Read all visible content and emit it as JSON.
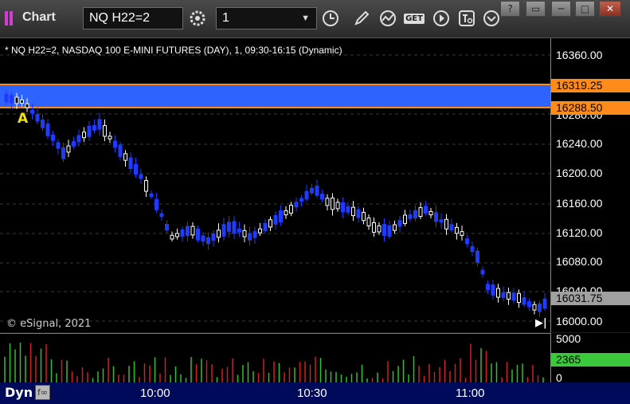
{
  "window": {
    "title": "Chart",
    "symbol": "NQ H22=2",
    "interval": "1"
  },
  "chart": {
    "description": "* NQ H22=2, NASDAQ 100 E-MINI FUTURES (DAY), 1, 09:30-16:15 (Dynamic)",
    "watermark": "© eSignal, 2021",
    "marker_label": "A",
    "price_ticks": [
      "16360.00",
      "16280.00",
      "16240.00",
      "16200.00",
      "16160.00",
      "16120.00",
      "16080.00",
      "16040.00",
      "16000.00"
    ],
    "level_high": "16319.25",
    "level_low": "16288.50",
    "last_price": "16031.75",
    "colors": {
      "band": "#2f63ff",
      "level": "#ff8c1a",
      "up_candle": "#ffffff",
      "down_candle": "#1f3bff",
      "last_tag": "#a0a0a0"
    }
  },
  "volume": {
    "ticks": [
      "5000",
      "0"
    ],
    "current": "2365",
    "current_color": "#3cc83c"
  },
  "time_axis": {
    "labels": [
      "10:00",
      "10:30",
      "11:00"
    ]
  },
  "bottom": {
    "dyn_label": "Dyn"
  },
  "window_buttons": [
    "?",
    "▭",
    "─",
    "□",
    "✕"
  ]
}
